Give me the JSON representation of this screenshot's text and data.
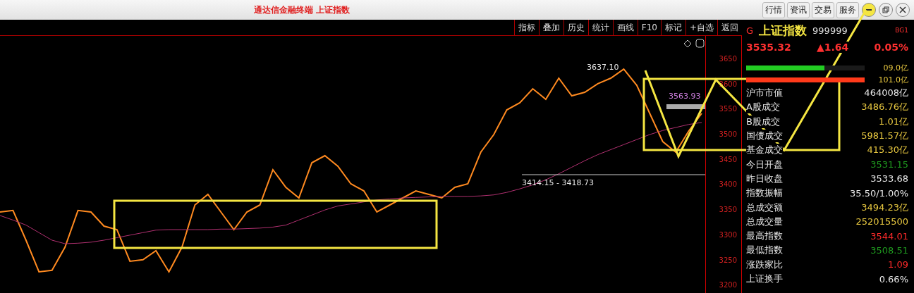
{
  "window": {
    "title": "通达信金融终端 上证指数",
    "menu": [
      "行情",
      "资讯",
      "交易",
      "服务"
    ]
  },
  "toolbar": [
    "指标",
    "叠加",
    "历史",
    "统计",
    "画线",
    "F10",
    "标记",
    "+自选",
    "返回"
  ],
  "chart": {
    "marks": [
      {
        "kind": "peak",
        "text": "3637.10"
      },
      {
        "kind": "level",
        "text": "3563.93"
      },
      {
        "kind": "range",
        "text": "3414.15 - 3418.73"
      }
    ],
    "chart_data": {
      "type": "line",
      "ylim": [
        3185,
        3696
      ],
      "yticks": [
        3650,
        3600,
        3550,
        3500,
        3450,
        3400,
        3350,
        3300,
        3250,
        3200
      ],
      "series": [
        {
          "color": "#ff8a20",
          "values": [
            3346,
            3349,
            3290,
            3227,
            3230,
            3276,
            3349,
            3346,
            3318,
            3311,
            3248,
            3251,
            3269,
            3227,
            3276,
            3360,
            3381,
            3346,
            3311,
            3346,
            3360,
            3430,
            3395,
            3374,
            3444,
            3458,
            3437,
            3402,
            3388,
            3346,
            3360,
            3374,
            3388,
            3381,
            3374,
            3395,
            3402,
            3465,
            3500,
            3549,
            3563,
            3591,
            3570,
            3612,
            3577,
            3584,
            3601,
            3612,
            3630,
            3598,
            3542,
            3486,
            3465,
            3507,
            3542
          ]
        },
        {
          "color": "#b03070",
          "values": [
            3339,
            3330,
            3320,
            3305,
            3290,
            3283,
            3284,
            3286,
            3290,
            3295,
            3300,
            3305,
            3310,
            3311,
            3311,
            3311,
            3311,
            3312,
            3312,
            3313,
            3314,
            3316,
            3320,
            3330,
            3340,
            3350,
            3358,
            3362,
            3366,
            3370,
            3372,
            3374,
            3375,
            3376,
            3377,
            3377,
            3377,
            3378,
            3380,
            3385,
            3392,
            3400,
            3410,
            3422,
            3435,
            3448,
            3460,
            3470,
            3480,
            3490,
            3500,
            3508,
            3514,
            3520,
            3524
          ]
        }
      ]
    }
  },
  "quote": {
    "prefix": "G",
    "name": "上证指数",
    "code": "999999",
    "tag": "BG1",
    "price": "3535.32",
    "change": "▲1.64",
    "percent": "0.05%"
  },
  "flow": [
    {
      "value": "09.0亿",
      "color": "#22cc22",
      "level": 0.66
    },
    {
      "value": "101.0亿",
      "color": "#ff3a1a",
      "level": 1
    }
  ],
  "stats": [
    {
      "label": "沪市市值",
      "value": "464008亿",
      "color": "#e8e8e8"
    },
    {
      "label": "A股成交",
      "value": "3486.76亿",
      "color": "#e8c840"
    },
    {
      "label": "B股成交",
      "value": "1.01亿",
      "color": "#e8c840"
    },
    {
      "label": "国债成交",
      "value": "5981.57亿",
      "color": "#e8c840"
    },
    {
      "label": "基金成交",
      "value": "415.30亿",
      "color": "#e8c840"
    },
    {
      "label": "今日开盘",
      "value": "3531.15",
      "color": "#1f9a1f"
    },
    {
      "label": "昨日收盘",
      "value": "3533.68",
      "color": "#e8e8e8"
    },
    {
      "label": "指数振幅",
      "value": "35.50/1.00%",
      "color": "#e8e8e8"
    },
    {
      "label": "总成交额",
      "value": "3494.23亿",
      "color": "#e8c840"
    },
    {
      "label": "总成交量",
      "value": "252015500",
      "color": "#e8c840"
    },
    {
      "label": "最高指数",
      "value": "3544.01",
      "color": "#ff2a2a"
    },
    {
      "label": "最低指数",
      "value": "3508.51",
      "color": "#1f9a1f"
    },
    {
      "label": "涨跌家比",
      "value": "1.09",
      "color": "#ff2a2a"
    },
    {
      "label": "上证换手",
      "value": "0.66%",
      "color": "#e8e8e8"
    }
  ]
}
